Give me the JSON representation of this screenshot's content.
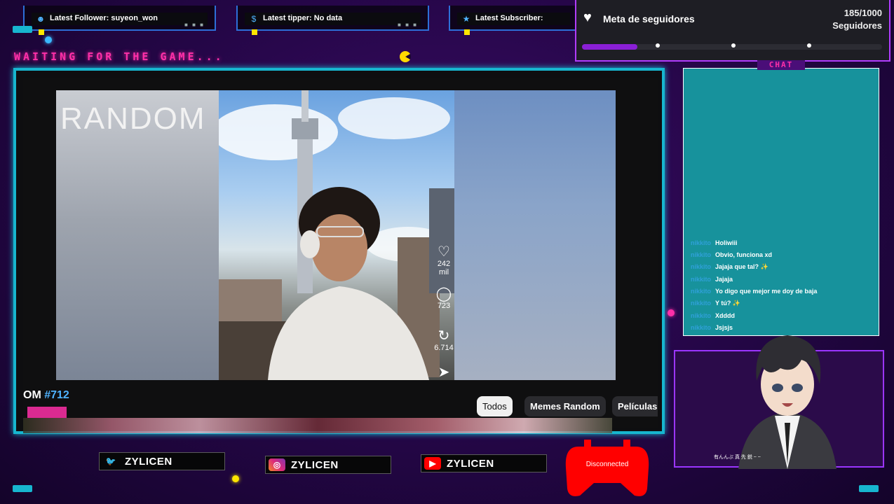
{
  "tickers": [
    {
      "icon": "user-icon",
      "glyph": "☻",
      "text": "Latest Follower: suyeon_won"
    },
    {
      "icon": "dollar-icon",
      "glyph": "$",
      "text": "Latest tipper: No data"
    },
    {
      "icon": "star-icon",
      "glyph": "★",
      "text": "Latest Subscriber:"
    }
  ],
  "waiting_text": "WAITING FOR THE GAME...",
  "goal": {
    "title": "Meta de seguidores",
    "count": "185/1000",
    "unit": "Seguidores",
    "progress_fraction": 0.185,
    "accent": "#8a1fd6"
  },
  "screen": {
    "panel_left_text": "RANDOM",
    "episode_prefix": "OM ",
    "episode_number": "#712",
    "video_stats": {
      "likes": "242 mil",
      "comments": "723",
      "shares": "6.714"
    },
    "pills": [
      "Todos",
      "Memes Random",
      "Películas e"
    ],
    "active_pill": "Todos"
  },
  "chat": {
    "title": "CHAT",
    "messages": [
      {
        "user": "nikkito",
        "text": "Holiwiii"
      },
      {
        "user": "nikkito",
        "text": "Obvio, funciona xd"
      },
      {
        "user": "nikkito",
        "text": "Jajaja que tal? ✨"
      },
      {
        "user": "nikkito",
        "text": "Jajaja"
      },
      {
        "user": "nikkito",
        "text": "Yo digo que mejor me doy de baja"
      },
      {
        "user": "nikkito",
        "text": "Y tú? ✨"
      },
      {
        "user": "nikkito",
        "text": "Xdddd"
      },
      {
        "user": "nikkito",
        "text": "Jsjsjs"
      }
    ]
  },
  "avatar": {
    "caption": "有んんぶ 真 先 鋭 ~ ~"
  },
  "socials": [
    {
      "platform": "twitter-icon",
      "glyph": "🐦",
      "handle": "ZYLICEN",
      "color": "#1d9bf0"
    },
    {
      "platform": "instagram-icon",
      "glyph": "◎",
      "handle": "ZYLICEN",
      "color": "#e1306c"
    },
    {
      "platform": "youtube-icon",
      "glyph": "▶",
      "handle": "ZYLICEN",
      "color": "#ff0000"
    }
  ],
  "controller": {
    "status": "Disconnected",
    "color": "#ff0000"
  },
  "colors": {
    "frame": "#17b6cf",
    "neon_pink": "#ff2fa8",
    "purple": "#9b35ff"
  }
}
